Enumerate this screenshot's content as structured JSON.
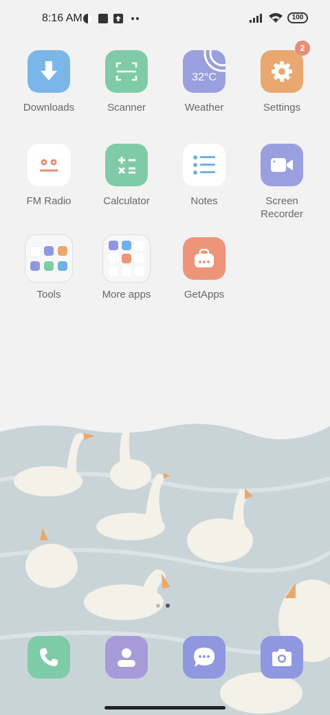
{
  "status_bar": {
    "time": "8:16 AM",
    "battery": "100"
  },
  "apps": [
    {
      "name": "Downloads",
      "color": "#7ab7e8"
    },
    {
      "name": "Scanner",
      "color": "#7fcba8"
    },
    {
      "name": "Weather",
      "color": "#9aa0dd",
      "temp": "32°C"
    },
    {
      "name": "Settings",
      "color": "#e9a86f",
      "badge": "2"
    },
    {
      "name": "FM Radio",
      "color": "#ffffff"
    },
    {
      "name": "Calculator",
      "color": "#7fcba8"
    },
    {
      "name": "Notes",
      "color": "#ffffff"
    },
    {
      "name": "Screen Recorder",
      "color": "#9aa0dd"
    },
    {
      "name": "Tools"
    },
    {
      "name": "More apps"
    },
    {
      "name": "GetApps",
      "color": "#ee9479"
    }
  ],
  "dock": [
    {
      "name": "Phone",
      "color": "#7fcba8"
    },
    {
      "name": "Contacts",
      "color": "#a69ad9"
    },
    {
      "name": "Messages",
      "color": "#8f97e0"
    },
    {
      "name": "Camera",
      "color": "#8f97e0"
    }
  ],
  "page_indicator": {
    "pages": 2,
    "current": 2
  }
}
